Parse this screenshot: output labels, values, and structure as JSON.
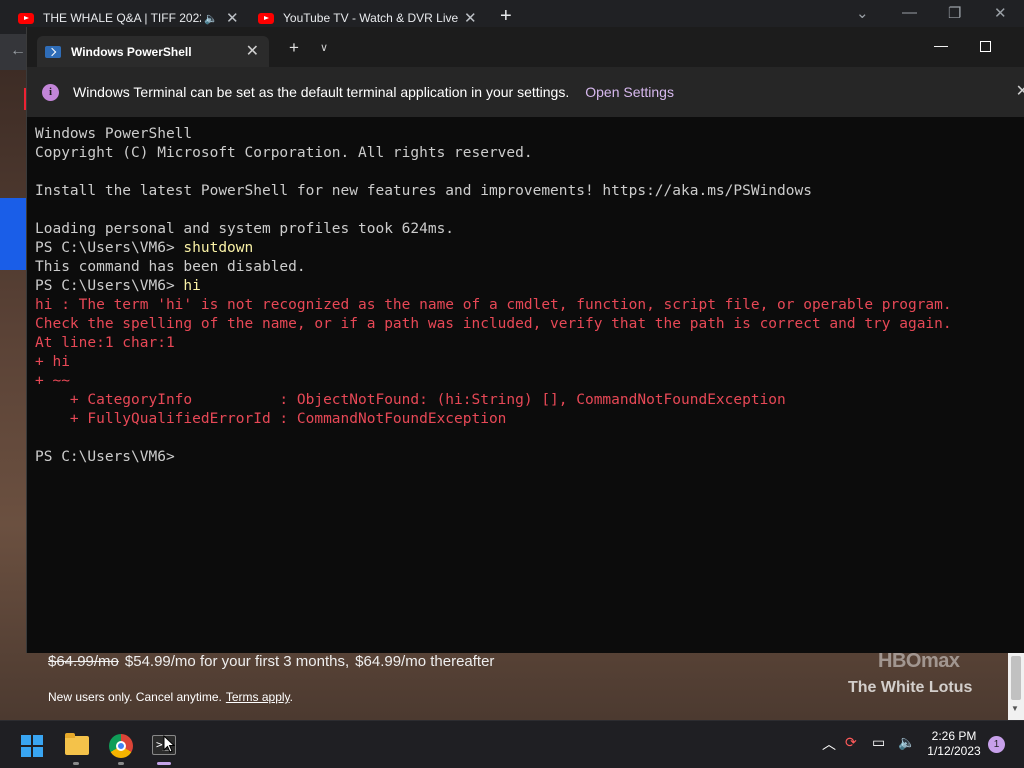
{
  "browser": {
    "tabs": [
      {
        "title": "THE WHALE Q&A | TIFF 2022",
        "close": "✕"
      },
      {
        "title": "YouTube TV - Watch & DVR Live",
        "close": "✕"
      }
    ],
    "new_tab": "+"
  },
  "background_page": {
    "old_price": "$64.99/mo",
    "promo_price": "$54.99/mo for your first 3 months,",
    "after_price": "$64.99/mo thereafter",
    "fine_print": "New users only. Cancel anytime.",
    "terms_link": "Terms apply",
    "terms_period": ".",
    "brand": "HBOmax",
    "show_title": "The White Lotus"
  },
  "terminal": {
    "tab_title": "Windows PowerShell",
    "infobar": {
      "message": "Windows Terminal can be set as the default terminal application in your settings.",
      "link": "Open Settings"
    },
    "lines": [
      {
        "prompt": "",
        "text": "Windows PowerShell",
        "kind": "out"
      },
      {
        "prompt": "",
        "text": "Copyright (C) Microsoft Corporation. All rights reserved.",
        "kind": "out"
      },
      {
        "prompt": "",
        "text": "",
        "kind": "out"
      },
      {
        "prompt": "",
        "text": "Install the latest PowerShell for new features and improvements! https://aka.ms/PSWindows",
        "kind": "out"
      },
      {
        "prompt": "",
        "text": "",
        "kind": "out"
      },
      {
        "prompt": "",
        "text": "Loading personal and system profiles took 624ms.",
        "kind": "out"
      },
      {
        "prompt": "PS C:\\Users\\VM6> ",
        "text": "shutdown",
        "kind": "cmd"
      },
      {
        "prompt": "",
        "text": "This command has been disabled.",
        "kind": "out"
      },
      {
        "prompt": "PS C:\\Users\\VM6> ",
        "text": "hi",
        "kind": "cmd"
      },
      {
        "prompt": "",
        "text": "hi : The term 'hi' is not recognized as the name of a cmdlet, function, script file, or operable program.",
        "kind": "err"
      },
      {
        "prompt": "",
        "text": "Check the spelling of the name, or if a path was included, verify that the path is correct and try again.",
        "kind": "err"
      },
      {
        "prompt": "",
        "text": "At line:1 char:1",
        "kind": "err"
      },
      {
        "prompt": "",
        "text": "+ hi",
        "kind": "err"
      },
      {
        "prompt": "",
        "text": "+ ~~",
        "kind": "err"
      },
      {
        "prompt": "",
        "text": "    + CategoryInfo          : ObjectNotFound: (hi:String) [], CommandNotFoundException",
        "kind": "err"
      },
      {
        "prompt": "",
        "text": "    + FullyQualifiedErrorId : CommandNotFoundException",
        "kind": "err"
      },
      {
        "prompt": "",
        "text": "",
        "kind": "out"
      },
      {
        "prompt": "PS C:\\Users\\VM6>",
        "text": "",
        "kind": "cmd"
      }
    ]
  },
  "taskbar": {
    "time": "2:26 PM",
    "date": "1/12/2023",
    "notification_count": "1",
    "icons": [
      "windows-start-icon",
      "file-explorer-icon",
      "chrome-icon",
      "terminal-icon"
    ]
  },
  "colors": {
    "terminal_bg": "#0c0c0c",
    "error_text": "#e74856",
    "command_text": "#f9f1a5",
    "output_text": "#cccccc",
    "link_accent": "#d7b8ee"
  }
}
